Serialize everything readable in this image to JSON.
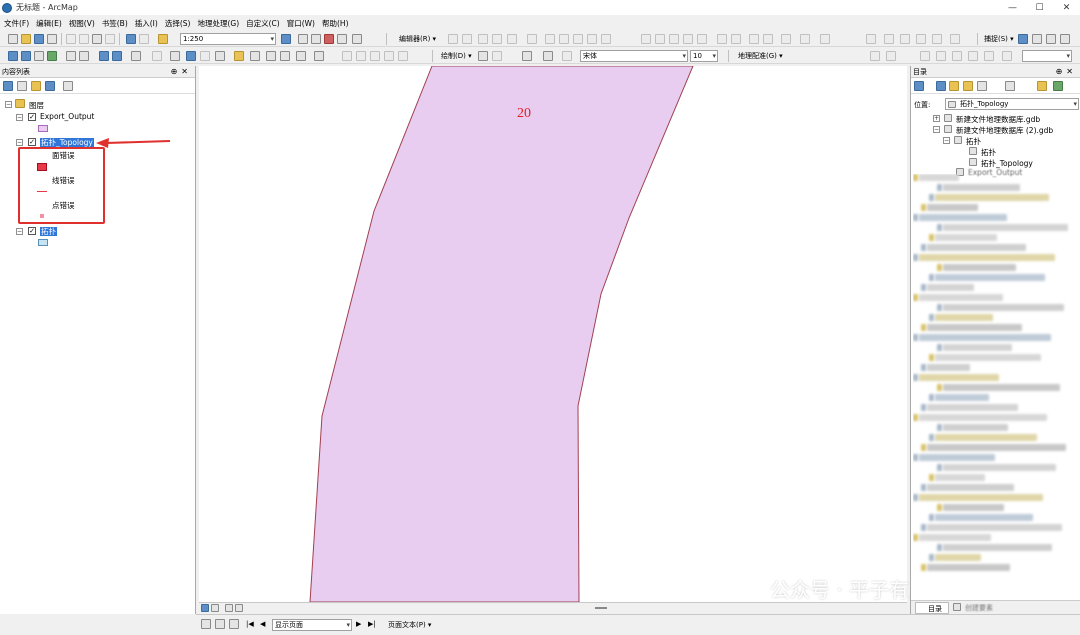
{
  "window": {
    "title": "无标题 - ArcMap"
  },
  "menu": [
    "文件(F)",
    "编辑(E)",
    "视图(V)",
    "书签(B)",
    "插入(I)",
    "选择(S)",
    "地理处理(G)",
    "自定义(C)",
    "窗口(W)",
    "帮助(H)"
  ],
  "toolbar": {
    "scale": "1:250",
    "editor": "编辑器(R) ▾",
    "snapping": "捕捉(S) ▾",
    "draw": "绘制(D) ▾",
    "font": "宋体",
    "font_size": "10",
    "georef": "地理配准(G) ▾"
  },
  "toc": {
    "title": "内容列表",
    "root": "图层",
    "layers": [
      {
        "name": "Export_Output"
      },
      {
        "name": "拓扑_Topology",
        "sub": [
          "面错误",
          "线错误",
          "点错误"
        ]
      },
      {
        "name": "拓扑"
      }
    ]
  },
  "map": {
    "label": "20",
    "fill": "#e8cdf0",
    "stroke": "#a04050"
  },
  "status": {
    "page": "显示页面",
    "page_text": "页面文本(P) ▾"
  },
  "catalog": {
    "title": "目录",
    "location_label": "位置:",
    "location_value": "拓扑_Topology",
    "items": [
      "新建文件地理数据库.gdb",
      "新建文件地理数据库 (2).gdb",
      "拓扑",
      "拓扑",
      "拓扑_Topology",
      "Export_Output"
    ],
    "tabs": [
      "目录",
      "创建要素"
    ]
  },
  "watermark": "公众号 · 平子有丛木"
}
